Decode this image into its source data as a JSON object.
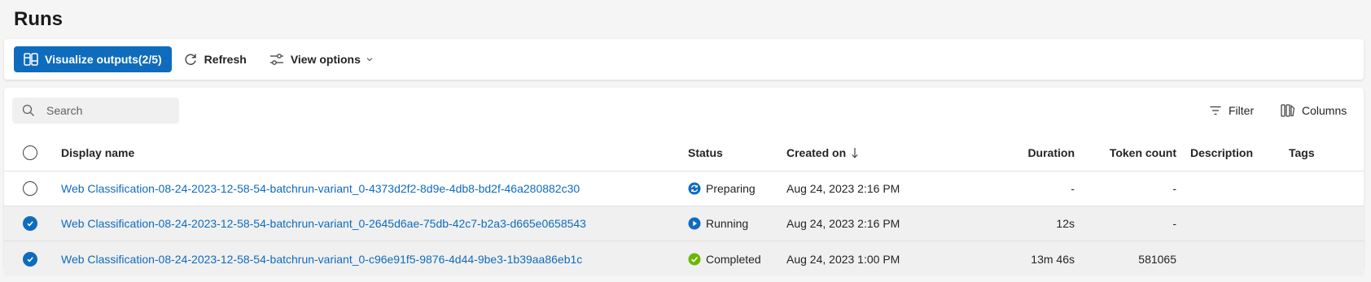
{
  "page": {
    "title": "Runs"
  },
  "toolbar": {
    "visualize_label": "Visualize outputs(2/5)",
    "refresh_label": "Refresh",
    "view_options_label": "View options"
  },
  "panel": {
    "search_placeholder": "Search",
    "filter_label": "Filter",
    "columns_label": "Columns"
  },
  "table": {
    "headers": {
      "name": "Display name",
      "status": "Status",
      "created": "Created on",
      "duration": "Duration",
      "tokens": "Token count",
      "description": "Description",
      "tags": "Tags"
    },
    "sort": {
      "column": "created",
      "direction": "descending",
      "icon": "arrow-down-icon"
    },
    "rows": [
      {
        "selected": false,
        "name": "Web Classification-08-24-2023-12-58-54-batchrun-variant_0-4373d2f2-8d9e-4db8-bd2f-46a280882c30",
        "status": "Preparing",
        "status_icon": "sync-icon",
        "created": "Aug 24, 2023 2:16 PM",
        "duration": "-",
        "tokens": "-",
        "description": "",
        "tags": ""
      },
      {
        "selected": true,
        "name": "Web Classification-08-24-2023-12-58-54-batchrun-variant_0-2645d6ae-75db-42c7-b2a3-d665e0658543",
        "status": "Running",
        "status_icon": "play-icon",
        "created": "Aug 24, 2023 2:16 PM",
        "duration": "12s",
        "tokens": "-",
        "description": "",
        "tags": ""
      },
      {
        "selected": true,
        "name": "Web Classification-08-24-2023-12-58-54-batchrun-variant_0-c96e91f5-9876-4d44-9be3-1b39aa86eb1c",
        "status": "Completed",
        "status_icon": "check-circle-icon",
        "created": "Aug 24, 2023 1:00 PM",
        "duration": "13m 46s",
        "tokens": "581065",
        "description": "",
        "tags": ""
      }
    ]
  },
  "colors": {
    "accent": "#0f6cbd",
    "preparing": "#0f6cbd",
    "running": "#0f6cbd",
    "completed": "#6bb700"
  }
}
